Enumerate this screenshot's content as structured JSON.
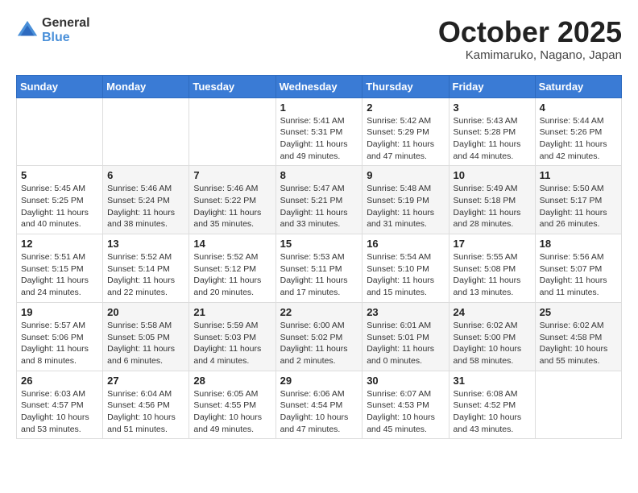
{
  "header": {
    "logo_general": "General",
    "logo_blue": "Blue",
    "month": "October 2025",
    "location": "Kamimaruko, Nagano, Japan"
  },
  "weekdays": [
    "Sunday",
    "Monday",
    "Tuesday",
    "Wednesday",
    "Thursday",
    "Friday",
    "Saturday"
  ],
  "weeks": [
    [
      {
        "day": "",
        "detail": ""
      },
      {
        "day": "",
        "detail": ""
      },
      {
        "day": "",
        "detail": ""
      },
      {
        "day": "1",
        "detail": "Sunrise: 5:41 AM\nSunset: 5:31 PM\nDaylight: 11 hours\nand 49 minutes."
      },
      {
        "day": "2",
        "detail": "Sunrise: 5:42 AM\nSunset: 5:29 PM\nDaylight: 11 hours\nand 47 minutes."
      },
      {
        "day": "3",
        "detail": "Sunrise: 5:43 AM\nSunset: 5:28 PM\nDaylight: 11 hours\nand 44 minutes."
      },
      {
        "day": "4",
        "detail": "Sunrise: 5:44 AM\nSunset: 5:26 PM\nDaylight: 11 hours\nand 42 minutes."
      }
    ],
    [
      {
        "day": "5",
        "detail": "Sunrise: 5:45 AM\nSunset: 5:25 PM\nDaylight: 11 hours\nand 40 minutes."
      },
      {
        "day": "6",
        "detail": "Sunrise: 5:46 AM\nSunset: 5:24 PM\nDaylight: 11 hours\nand 38 minutes."
      },
      {
        "day": "7",
        "detail": "Sunrise: 5:46 AM\nSunset: 5:22 PM\nDaylight: 11 hours\nand 35 minutes."
      },
      {
        "day": "8",
        "detail": "Sunrise: 5:47 AM\nSunset: 5:21 PM\nDaylight: 11 hours\nand 33 minutes."
      },
      {
        "day": "9",
        "detail": "Sunrise: 5:48 AM\nSunset: 5:19 PM\nDaylight: 11 hours\nand 31 minutes."
      },
      {
        "day": "10",
        "detail": "Sunrise: 5:49 AM\nSunset: 5:18 PM\nDaylight: 11 hours\nand 28 minutes."
      },
      {
        "day": "11",
        "detail": "Sunrise: 5:50 AM\nSunset: 5:17 PM\nDaylight: 11 hours\nand 26 minutes."
      }
    ],
    [
      {
        "day": "12",
        "detail": "Sunrise: 5:51 AM\nSunset: 5:15 PM\nDaylight: 11 hours\nand 24 minutes."
      },
      {
        "day": "13",
        "detail": "Sunrise: 5:52 AM\nSunset: 5:14 PM\nDaylight: 11 hours\nand 22 minutes."
      },
      {
        "day": "14",
        "detail": "Sunrise: 5:52 AM\nSunset: 5:12 PM\nDaylight: 11 hours\nand 20 minutes."
      },
      {
        "day": "15",
        "detail": "Sunrise: 5:53 AM\nSunset: 5:11 PM\nDaylight: 11 hours\nand 17 minutes."
      },
      {
        "day": "16",
        "detail": "Sunrise: 5:54 AM\nSunset: 5:10 PM\nDaylight: 11 hours\nand 15 minutes."
      },
      {
        "day": "17",
        "detail": "Sunrise: 5:55 AM\nSunset: 5:08 PM\nDaylight: 11 hours\nand 13 minutes."
      },
      {
        "day": "18",
        "detail": "Sunrise: 5:56 AM\nSunset: 5:07 PM\nDaylight: 11 hours\nand 11 minutes."
      }
    ],
    [
      {
        "day": "19",
        "detail": "Sunrise: 5:57 AM\nSunset: 5:06 PM\nDaylight: 11 hours\nand 8 minutes."
      },
      {
        "day": "20",
        "detail": "Sunrise: 5:58 AM\nSunset: 5:05 PM\nDaylight: 11 hours\nand 6 minutes."
      },
      {
        "day": "21",
        "detail": "Sunrise: 5:59 AM\nSunset: 5:03 PM\nDaylight: 11 hours\nand 4 minutes."
      },
      {
        "day": "22",
        "detail": "Sunrise: 6:00 AM\nSunset: 5:02 PM\nDaylight: 11 hours\nand 2 minutes."
      },
      {
        "day": "23",
        "detail": "Sunrise: 6:01 AM\nSunset: 5:01 PM\nDaylight: 11 hours\nand 0 minutes."
      },
      {
        "day": "24",
        "detail": "Sunrise: 6:02 AM\nSunset: 5:00 PM\nDaylight: 10 hours\nand 58 minutes."
      },
      {
        "day": "25",
        "detail": "Sunrise: 6:02 AM\nSunset: 4:58 PM\nDaylight: 10 hours\nand 55 minutes."
      }
    ],
    [
      {
        "day": "26",
        "detail": "Sunrise: 6:03 AM\nSunset: 4:57 PM\nDaylight: 10 hours\nand 53 minutes."
      },
      {
        "day": "27",
        "detail": "Sunrise: 6:04 AM\nSunset: 4:56 PM\nDaylight: 10 hours\nand 51 minutes."
      },
      {
        "day": "28",
        "detail": "Sunrise: 6:05 AM\nSunset: 4:55 PM\nDaylight: 10 hours\nand 49 minutes."
      },
      {
        "day": "29",
        "detail": "Sunrise: 6:06 AM\nSunset: 4:54 PM\nDaylight: 10 hours\nand 47 minutes."
      },
      {
        "day": "30",
        "detail": "Sunrise: 6:07 AM\nSunset: 4:53 PM\nDaylight: 10 hours\nand 45 minutes."
      },
      {
        "day": "31",
        "detail": "Sunrise: 6:08 AM\nSunset: 4:52 PM\nDaylight: 10 hours\nand 43 minutes."
      },
      {
        "day": "",
        "detail": ""
      }
    ]
  ]
}
